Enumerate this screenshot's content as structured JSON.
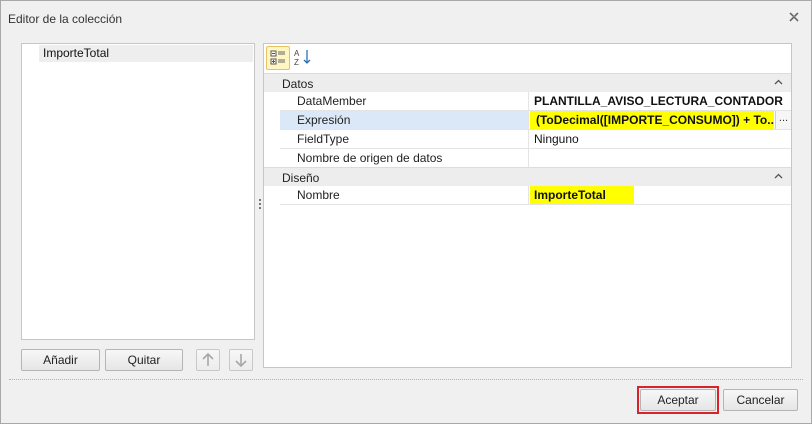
{
  "window": {
    "title": "Editor de la colección"
  },
  "collection": {
    "items": [
      {
        "label": "ImporteTotal"
      }
    ],
    "add_label": "Añadir",
    "remove_label": "Quitar"
  },
  "property_grid": {
    "categories": [
      {
        "label": "Datos",
        "properties": [
          {
            "name": "DataMember",
            "value": "PLANTILLA_AVISO_LECTURA_CONTADOR"
          },
          {
            "name": "Expresión",
            "value": "(ToDecimal([IMPORTE_CONSUMO]) + To..."
          },
          {
            "name": "FieldType",
            "value": "Ninguno"
          },
          {
            "name": "Nombre de origen de datos",
            "value": ""
          }
        ]
      },
      {
        "label": "Diseño",
        "properties": [
          {
            "name": "Nombre",
            "value": "ImporteTotal"
          }
        ]
      }
    ],
    "ellipsis_label": "..."
  },
  "footer": {
    "ok_label": "Aceptar",
    "cancel_label": "Cancelar"
  },
  "colors": {
    "highlight": "#ffff00",
    "focus_border": "#d9232c",
    "selected_row": "#dbe8f7"
  },
  "icons": [
    "close-icon",
    "categorized-icon",
    "alphabetical-sort-icon",
    "arrow-up-icon",
    "arrow-down-icon",
    "collapse-icon"
  ]
}
